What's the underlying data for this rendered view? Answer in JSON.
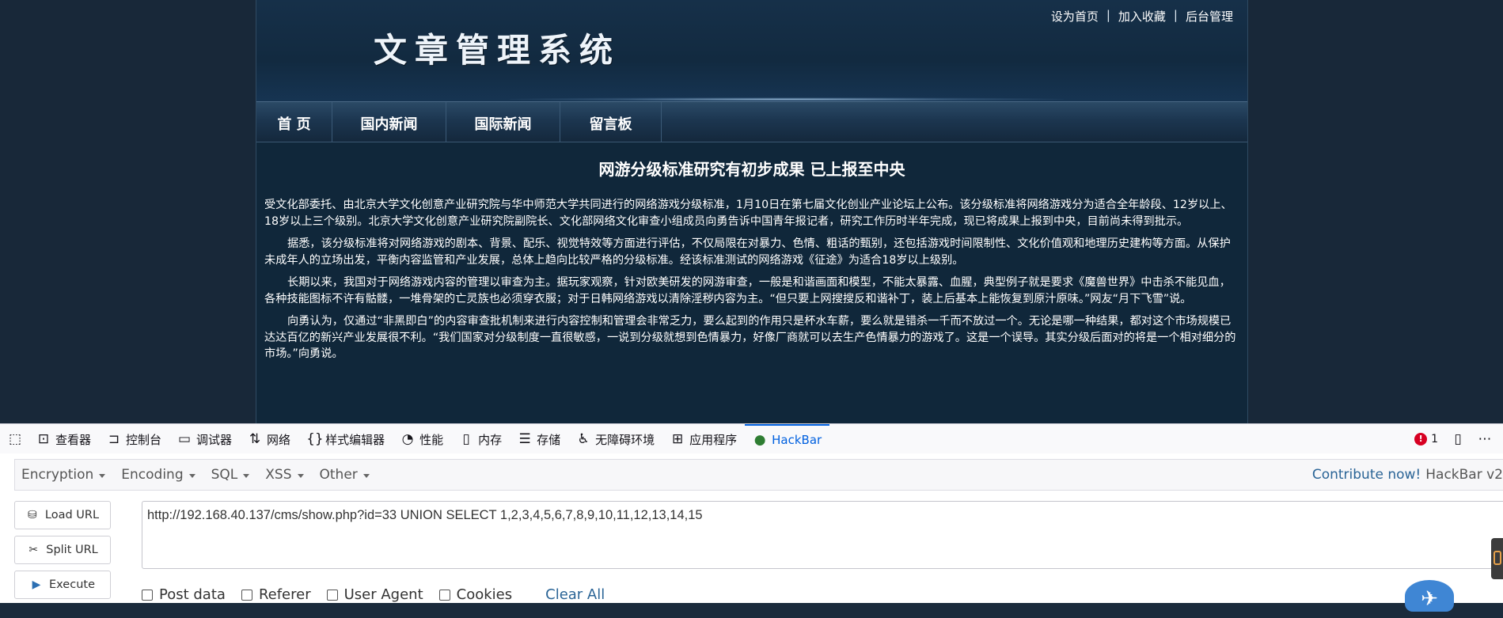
{
  "site": {
    "title": "文章管理系统",
    "toplinks": [
      "设为首页",
      "加入收藏",
      "后台管理"
    ],
    "separator": "|",
    "nav": [
      "首 页",
      "国内新闻",
      "国际新闻",
      "留言板"
    ],
    "article": {
      "title": "网游分级标准研究有初步成果 已上报至中央",
      "paragraphs": [
        "受文化部委托、由北京大学文化创意产业研究院与华中师范大学共同进行的网络游戏分级标准，1月10日在第七届文化创业产业论坛上公布。该分级标准将网络游戏分为适合全年龄段、12岁以上、18岁以上三个级别。北京大学文化创意产业研究院副院长、文化部网络文化审查小组成员向勇告诉中国青年报记者，研究工作历时半年完成，现已将成果上报到中央，目前尚未得到批示。",
        "据悉，该分级标准将对网络游戏的剧本、背景、配乐、视觉特效等方面进行评估，不仅局限在对暴力、色情、粗话的甄别，还包括游戏时间限制性、文化价值观和地理历史建构等方面。从保护未成年人的立场出发，平衡内容监管和产业发展，总体上趋向比较严格的分级标准。经该标准测试的网络游戏《征途》为适合18岁以上级别。",
        "长期以来，我国对于网络游戏内容的管理以审查为主。据玩家观察，针对欧美研发的网游审查，一般是和谐画面和模型，不能太暴露、血腥，典型例子就是要求《魔兽世界》中击杀不能见血，各种技能图标不许有骷髅，一堆骨架的亡灵族也必须穿衣服；对于日韩网络游戏以清除淫秽内容为主。“但只要上网搜搜反和谐补丁，装上后基本上能恢复到原汁原味。”网友“月下飞雪”说。",
        "向勇认为，仅通过“非黑即白”的内容审查批机制来进行内容控制和管理会非常乏力，要么起到的作用只是杯水车薪，要么就是错杀一千而不放过一个。无论是哪一种结果，都对这个市场规模已达达百亿的新兴产业发展很不利。“我们国家对分级制度一直很敏感，一说到分级就想到色情暴力，好像厂商就可以去生产色情暴力的游戏了。这是一个误导。其实分级后面对的将是一个相对细分的市场。”向勇说。"
      ]
    }
  },
  "devtools": {
    "tabs": [
      {
        "label": "查看器",
        "icon": "inspector-icon"
      },
      {
        "label": "控制台",
        "icon": "console-icon"
      },
      {
        "label": "调试器",
        "icon": "debugger-icon"
      },
      {
        "label": "网络",
        "icon": "network-icon"
      },
      {
        "label": "样式编辑器",
        "icon": "style-editor-icon"
      },
      {
        "label": "性能",
        "icon": "performance-icon"
      },
      {
        "label": "内存",
        "icon": "memory-icon"
      },
      {
        "label": "存储",
        "icon": "storage-icon"
      },
      {
        "label": "无障碍环境",
        "icon": "accessibility-icon"
      },
      {
        "label": "应用程序",
        "icon": "application-icon"
      },
      {
        "label": "HackBar",
        "icon": "hackbar-icon"
      }
    ],
    "active_tab": "HackBar",
    "error_count": "1"
  },
  "hackbar": {
    "menu": [
      "Encryption",
      "Encoding",
      "SQL",
      "XSS",
      "Other"
    ],
    "contribute_label": "Contribute now!",
    "version_label": "HackBar v2",
    "buttons": {
      "load": "Load URL",
      "split": "Split URL",
      "execute": "Execute"
    },
    "url_value": "http://192.168.40.137/cms/show.php?id=33 UNION SELECT 1,2,3,4,5,6,7,8,9,10,11,12,13,14,15",
    "options": [
      "Post data",
      "Referer",
      "User Agent",
      "Cookies"
    ],
    "clear_all": "Clear All"
  },
  "colors": {
    "site_bg": "#182839",
    "container_bg": "#10273a",
    "devtools_active": "#0060df",
    "link_blue": "#2a6496",
    "error_red": "#d70022"
  }
}
